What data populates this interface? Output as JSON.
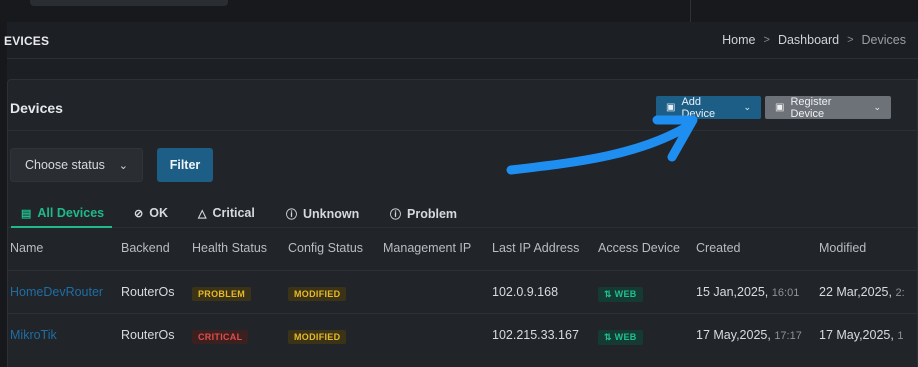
{
  "page": {
    "section_title": "EVICES",
    "breadcrumb": [
      "Home",
      "Dashboard",
      "Devices"
    ]
  },
  "card": {
    "title": "Devices",
    "add_device_label": "Add Device",
    "register_device_label": "Register Device"
  },
  "filters": {
    "status_select_value": "Choose status",
    "filter_button": "Filter"
  },
  "tabs": [
    {
      "label": "All Devices",
      "icon": "router-icon",
      "active": true
    },
    {
      "label": "OK",
      "icon": "check-circle-icon"
    },
    {
      "label": "Critical",
      "icon": "warning-triangle-icon"
    },
    {
      "label": "Unknown",
      "icon": "question-circle-icon"
    },
    {
      "label": "Problem",
      "icon": "info-circle-icon"
    }
  ],
  "table": {
    "columns": [
      "Name",
      "Backend",
      "Health Status",
      "Config Status",
      "Management IP",
      "Last IP Address",
      "Access Device",
      "Created",
      "Modified"
    ],
    "rows": [
      {
        "name": "HomeDevRouter",
        "backend": "RouterOs",
        "health": "PROBLEM",
        "config": "MODIFIED",
        "management_ip": "",
        "last_ip": "102.0.9.168",
        "access": "WEB",
        "created_date": "15 Jan,2025,",
        "created_time": "16:01",
        "modified_date": "22 Mar,2025,",
        "modified_time": "2:"
      },
      {
        "name": "MikroTik",
        "backend": "RouterOs",
        "health": "CRITICAL",
        "config": "MODIFIED",
        "management_ip": "",
        "last_ip": "102.215.33.167",
        "access": "WEB",
        "created_date": "17 May,2025,",
        "created_time": "17:17",
        "modified_date": "17 May,2025,",
        "modified_time": "1"
      }
    ]
  },
  "colors": {
    "accent": "#1d5e86",
    "success": "#1fb98a",
    "warning": "#e8b927",
    "danger": "#e34c4c",
    "annotation_arrow": "#1f8ef1"
  }
}
